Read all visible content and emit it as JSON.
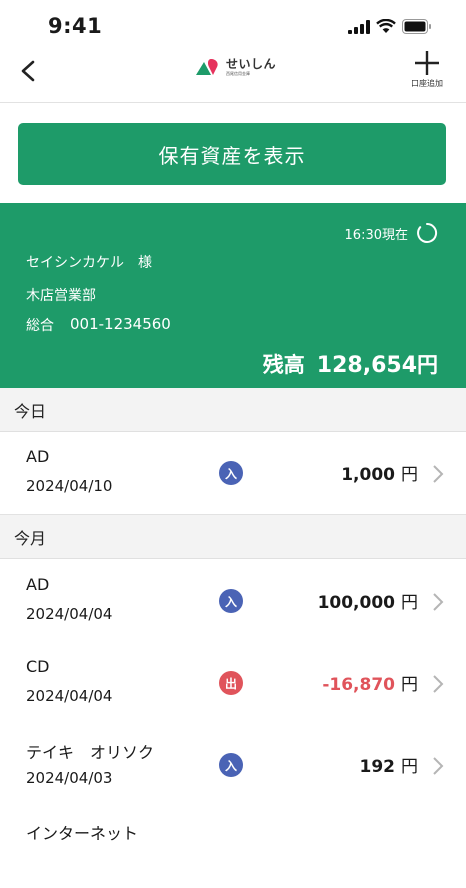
{
  "status_bar": {
    "time": "9:41"
  },
  "nav": {
    "logo_text": "せいしん",
    "logo_subtext": "西尾信用金庫",
    "add_label": "口座追加"
  },
  "show_assets_label": "保有資産を表示",
  "account": {
    "as_of": "16:30現在",
    "holder": "セイシンカケル　様",
    "branch": "木店営業部",
    "type": "総合",
    "number": "001-1234560",
    "balance_label": "残高",
    "balance_amount": "128,654",
    "balance_unit": "円"
  },
  "sections": [
    {
      "title": "今日",
      "transactions": [
        {
          "name": "AD",
          "date": "2024/04/10",
          "badge": "入",
          "amount": "1,000",
          "unit": "円"
        }
      ]
    },
    {
      "title": "今月",
      "transactions": [
        {
          "name": "AD",
          "date": "2024/04/04",
          "badge": "入",
          "amount": "100,000",
          "unit": "円"
        },
        {
          "name": "CD",
          "date": "2024/04/04",
          "badge": "出",
          "amount": "-16,870",
          "unit": "円"
        },
        {
          "name": "テイキ　オリソク",
          "date": "2024/04/03",
          "badge": "入",
          "amount": "192",
          "unit": "円"
        },
        {
          "name": "インターネット"
        }
      ]
    }
  ],
  "colors": {
    "brand_green": "#1e9b69",
    "deposit_badge": "#4a63b5",
    "withdrawal_badge": "#e0545b",
    "negative_amount": "#e0545b"
  }
}
